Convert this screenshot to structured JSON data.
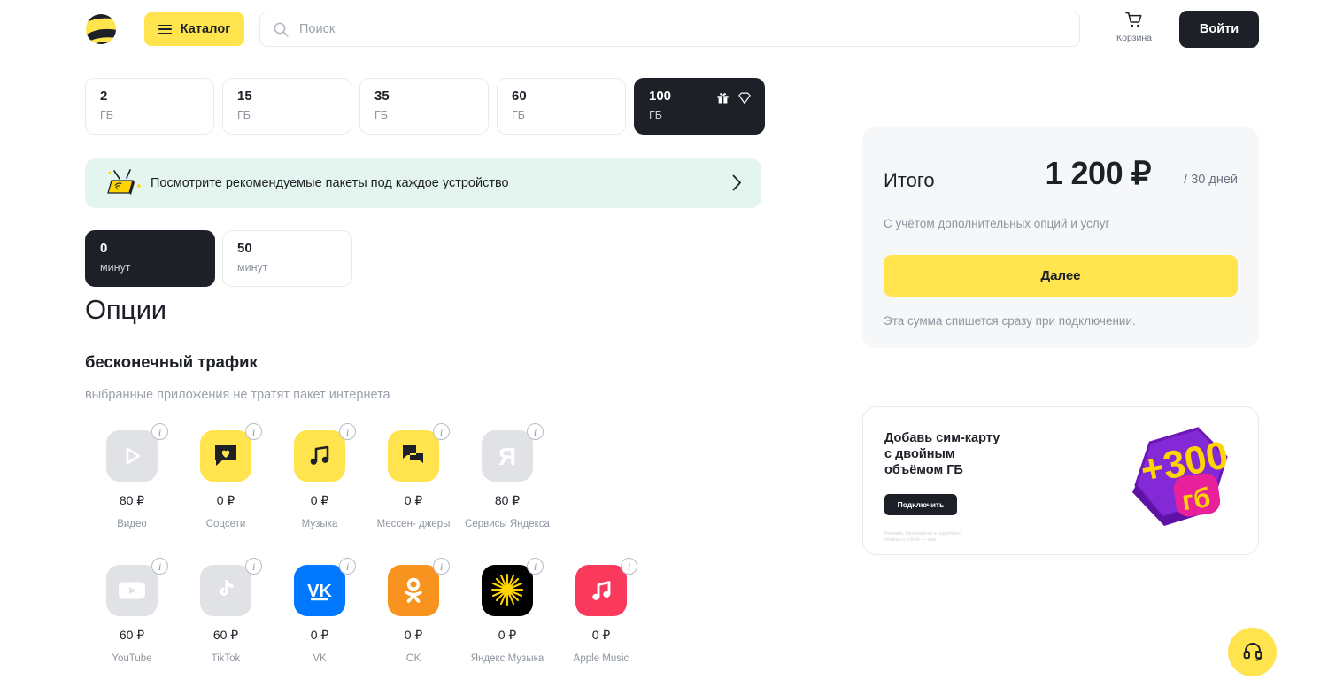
{
  "header": {
    "logo_name": "beeline-logo",
    "catalog_label": "Каталог",
    "search_placeholder": "Поиск",
    "search_value": "",
    "cart_label": "Корзина",
    "login_label": "Войти"
  },
  "gb_options": [
    {
      "value": "2",
      "unit": "ГБ",
      "selected": false
    },
    {
      "value": "15",
      "unit": "ГБ",
      "selected": false
    },
    {
      "value": "35",
      "unit": "ГБ",
      "selected": false
    },
    {
      "value": "60",
      "unit": "ГБ",
      "selected": false
    },
    {
      "value": "100",
      "unit": "ГБ",
      "selected": true
    }
  ],
  "promo_banner": {
    "text": "Посмотрите рекомендуемые пакеты под каждое устройство",
    "icon": "router-icon",
    "chevron": "chevron-right-icon"
  },
  "minutes_options": [
    {
      "value": "0",
      "unit": "минут",
      "selected": true
    },
    {
      "value": "50",
      "unit": "минут",
      "selected": false
    }
  ],
  "options_section": {
    "title": "Опции",
    "subsection_title": "бесконечный трафик",
    "subsection_subtitle": "выбранные приложения не тратят пакет интернета"
  },
  "apps_row1": [
    {
      "name": "Видео",
      "price": "80 ₽",
      "icon": "video-play-icon",
      "selected": false,
      "tile_bg": "#e0e2e6",
      "glyph_color": "#ffffff"
    },
    {
      "name": "Соцсети",
      "price": "0 ₽",
      "icon": "chat-heart-icon",
      "selected": true,
      "tile_bg": "#ffe44d",
      "glyph_color": "#1d2027"
    },
    {
      "name": "Музыка",
      "price": "0 ₽",
      "icon": "music-note-icon",
      "selected": true,
      "tile_bg": "#ffe44d",
      "glyph_color": "#1d2027"
    },
    {
      "name": "Мессен-\nджеры",
      "price": "0 ₽",
      "icon": "messenger-icon",
      "selected": true,
      "tile_bg": "#ffe44d",
      "glyph_color": "#1d2027"
    },
    {
      "name": "Сервисы\nЯндекса",
      "price": "80 ₽",
      "icon": "yandex-icon",
      "selected": false,
      "tile_bg": "#e0e2e6",
      "glyph_color": "#ffffff"
    }
  ],
  "apps_row2": [
    {
      "name": "YouTube",
      "price": "60 ₽",
      "icon": "youtube-icon",
      "selected": false,
      "tile_bg": "#e0e2e6",
      "glyph_color": "#ffffff"
    },
    {
      "name": "TikTok",
      "price": "60 ₽",
      "icon": "tiktok-icon",
      "selected": false,
      "tile_bg": "#e0e2e6",
      "glyph_color": "#ffffff"
    },
    {
      "name": "VK",
      "price": "0 ₽",
      "icon": "vk-icon",
      "selected": true,
      "tile_bg": "#0077ff",
      "glyph_color": "#ffffff"
    },
    {
      "name": "OK",
      "price": "0 ₽",
      "icon": "odnoklassniki-icon",
      "selected": true,
      "tile_bg": "#f7931e",
      "glyph_color": "#ffffff"
    },
    {
      "name": "Яндекс\nМузыка",
      "price": "0 ₽",
      "icon": "yandex-music-icon",
      "selected": true,
      "tile_bg": "#000000",
      "glyph_color": "#ffd400"
    },
    {
      "name": "Apple\nMusic",
      "price": "0 ₽",
      "icon": "apple-music-icon",
      "selected": true,
      "tile_bg": "#fa3a5c",
      "glyph_color": "#ffffff"
    }
  ],
  "total": {
    "label": "Итого",
    "amount": "1 200 ₽",
    "period": "/ 30 дней",
    "note": "С учётом дополнительных опций и услуг",
    "button_label": "Далее",
    "hint": "Эта сумма спишется сразу при подключении."
  },
  "ad": {
    "title": "Добавь сим-карту\nс двойным\nобъёмом ГБ",
    "button_label": "Подключить",
    "legal": "Реклама. Организатор и подробнее:\nbeeline.ru. «SIM» — сим",
    "art_main": "+300",
    "art_sub": "гб"
  },
  "support": {
    "icon": "headset-icon"
  },
  "colors": {
    "brand_yellow": "#ffe44d",
    "dark": "#1d2027",
    "banner_mint": "#e4f5f0",
    "card_grey": "#f6f7f8",
    "muted_text": "#8e959f"
  }
}
